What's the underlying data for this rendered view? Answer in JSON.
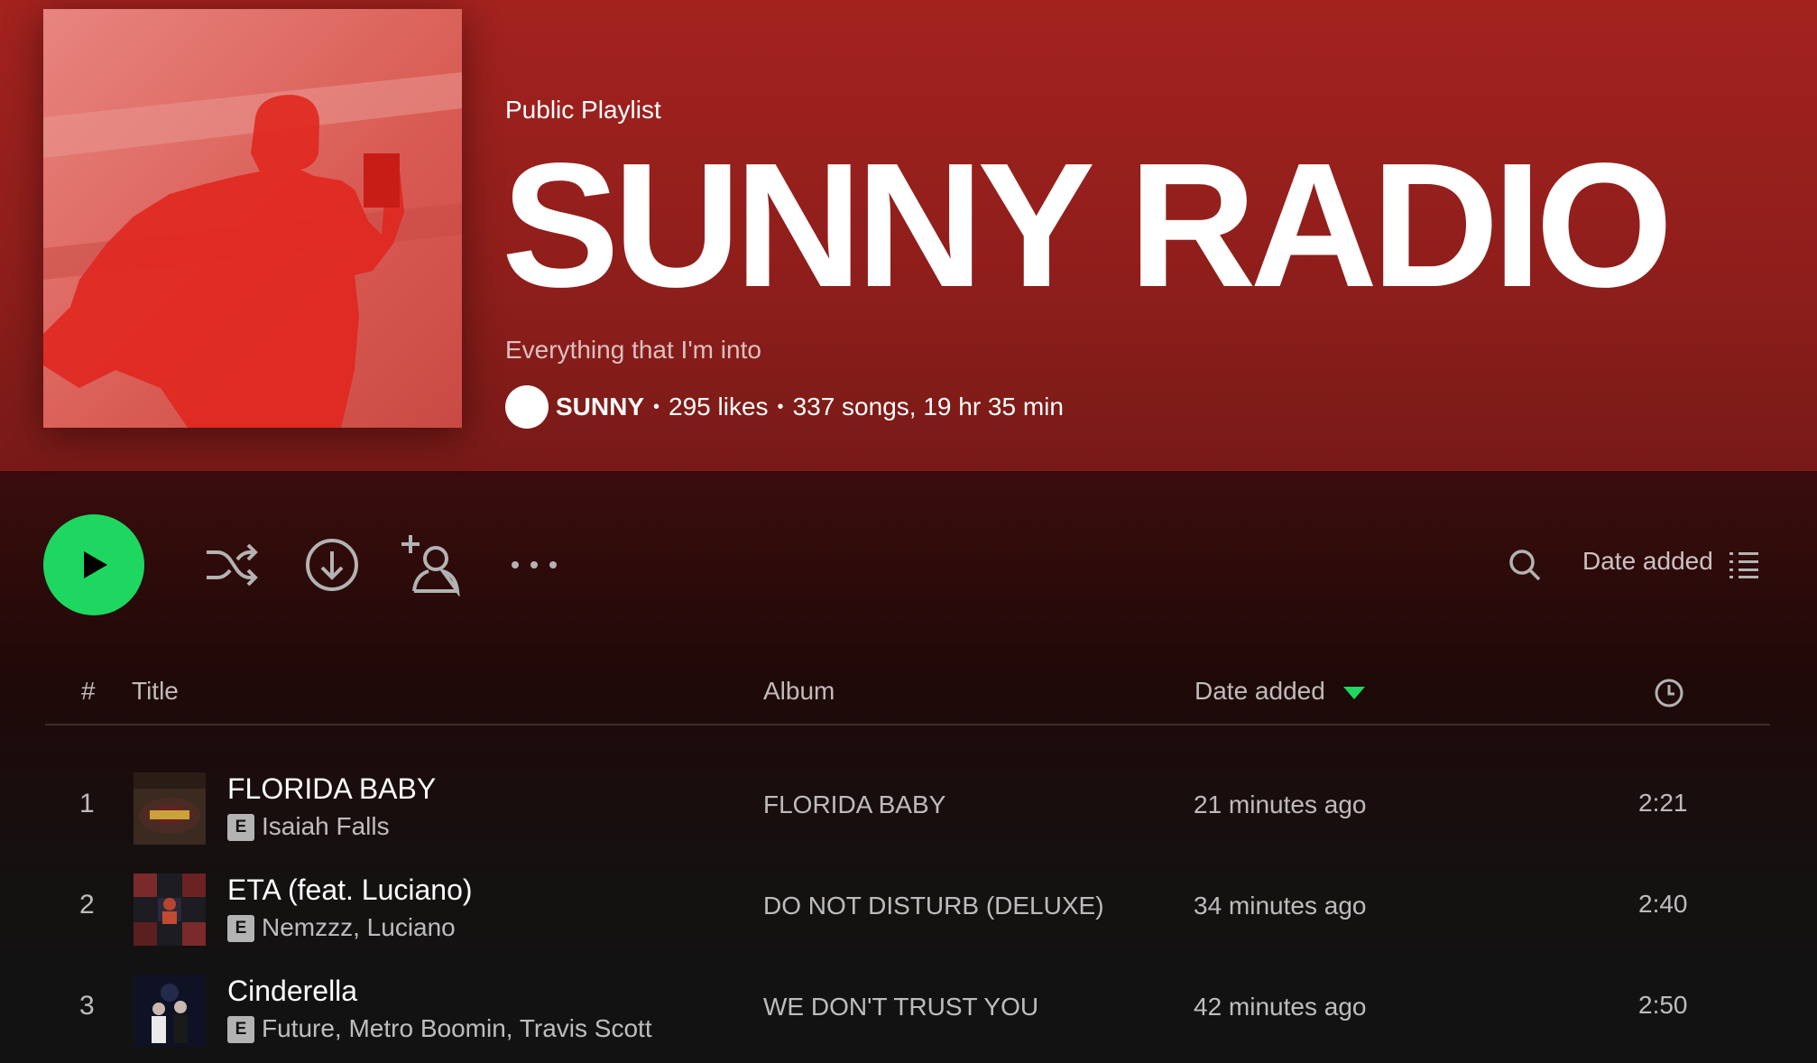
{
  "playlist": {
    "type_label": "Public Playlist",
    "title": "SUNNY RADIO",
    "description": "Everything that I'm into",
    "owner": "SUNNY",
    "likes": "295 likes",
    "stats": "337 songs, 19 hr 35 min"
  },
  "controls": {
    "sort_label": "Date added"
  },
  "table": {
    "headers": {
      "number": "#",
      "title": "Title",
      "album": "Album",
      "date_added": "Date added"
    },
    "rows": [
      {
        "index": "1",
        "title": "FLORIDA BABY",
        "explicit": "E",
        "artists": "Isaiah Falls",
        "album": "FLORIDA BABY",
        "added": "21 minutes ago",
        "duration": "2:21"
      },
      {
        "index": "2",
        "title": "ETA (feat. Luciano)",
        "explicit": "E",
        "artists": "Nemzzz, Luciano",
        "album": "DO NOT DISTURB (DELUXE)",
        "added": "34 minutes ago",
        "duration": "2:40"
      },
      {
        "index": "3",
        "title": "Cinderella",
        "explicit": "E",
        "artists": "Future, Metro Boomin, Travis Scott",
        "album": "WE DON'T TRUST YOU",
        "added": "42 minutes ago",
        "duration": "2:50"
      }
    ]
  },
  "colors": {
    "header_red": "#a3221e",
    "accent_green": "#1ed760",
    "background": "#121212"
  },
  "icons": [
    "play-icon",
    "shuffle-icon",
    "download-icon",
    "add-user-icon",
    "more-icon",
    "search-icon",
    "list-icon",
    "sort-arrow-icon",
    "clock-icon"
  ]
}
